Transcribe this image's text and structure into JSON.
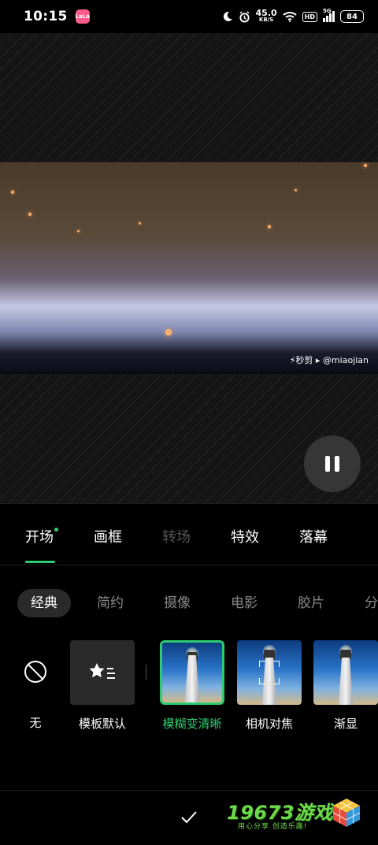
{
  "status_bar": {
    "time": "10:15",
    "app_badge": "LaLa",
    "net_speed_value": "45.0",
    "net_speed_unit": "KB/S",
    "hd_label": "HD",
    "signal_label": "5G",
    "battery": "84"
  },
  "preview": {
    "watermark": "⚡秒剪 ▸ @miaojian"
  },
  "tabs": [
    {
      "label": "开场",
      "active": true,
      "has_dot": true
    },
    {
      "label": "画框",
      "active": false
    },
    {
      "label": "转场",
      "active": false,
      "disabled": true
    },
    {
      "label": "特效",
      "active": false
    },
    {
      "label": "落幕",
      "active": false
    }
  ],
  "categories": [
    {
      "label": "经典",
      "active": true
    },
    {
      "label": "简约"
    },
    {
      "label": "摄像"
    },
    {
      "label": "电影"
    },
    {
      "label": "胶片"
    },
    {
      "label": "分"
    }
  ],
  "effects": {
    "none_label": "无",
    "template_default_label": "模板默认",
    "items": [
      {
        "label": "模糊变清晰",
        "selected": true,
        "icon": "lighthouse-thumb"
      },
      {
        "label": "相机对焦",
        "icon": "lighthouse-focus-thumb"
      },
      {
        "label": "渐显",
        "icon": "lighthouse-thumb"
      }
    ]
  },
  "bottom": {
    "confirm_icon": "checkmark-icon",
    "brand_name": "19673游戏",
    "brand_slogan": "用心分享 创造乐趣!"
  },
  "colors": {
    "accent": "#2ecc71",
    "brand": "#6fd94a"
  }
}
